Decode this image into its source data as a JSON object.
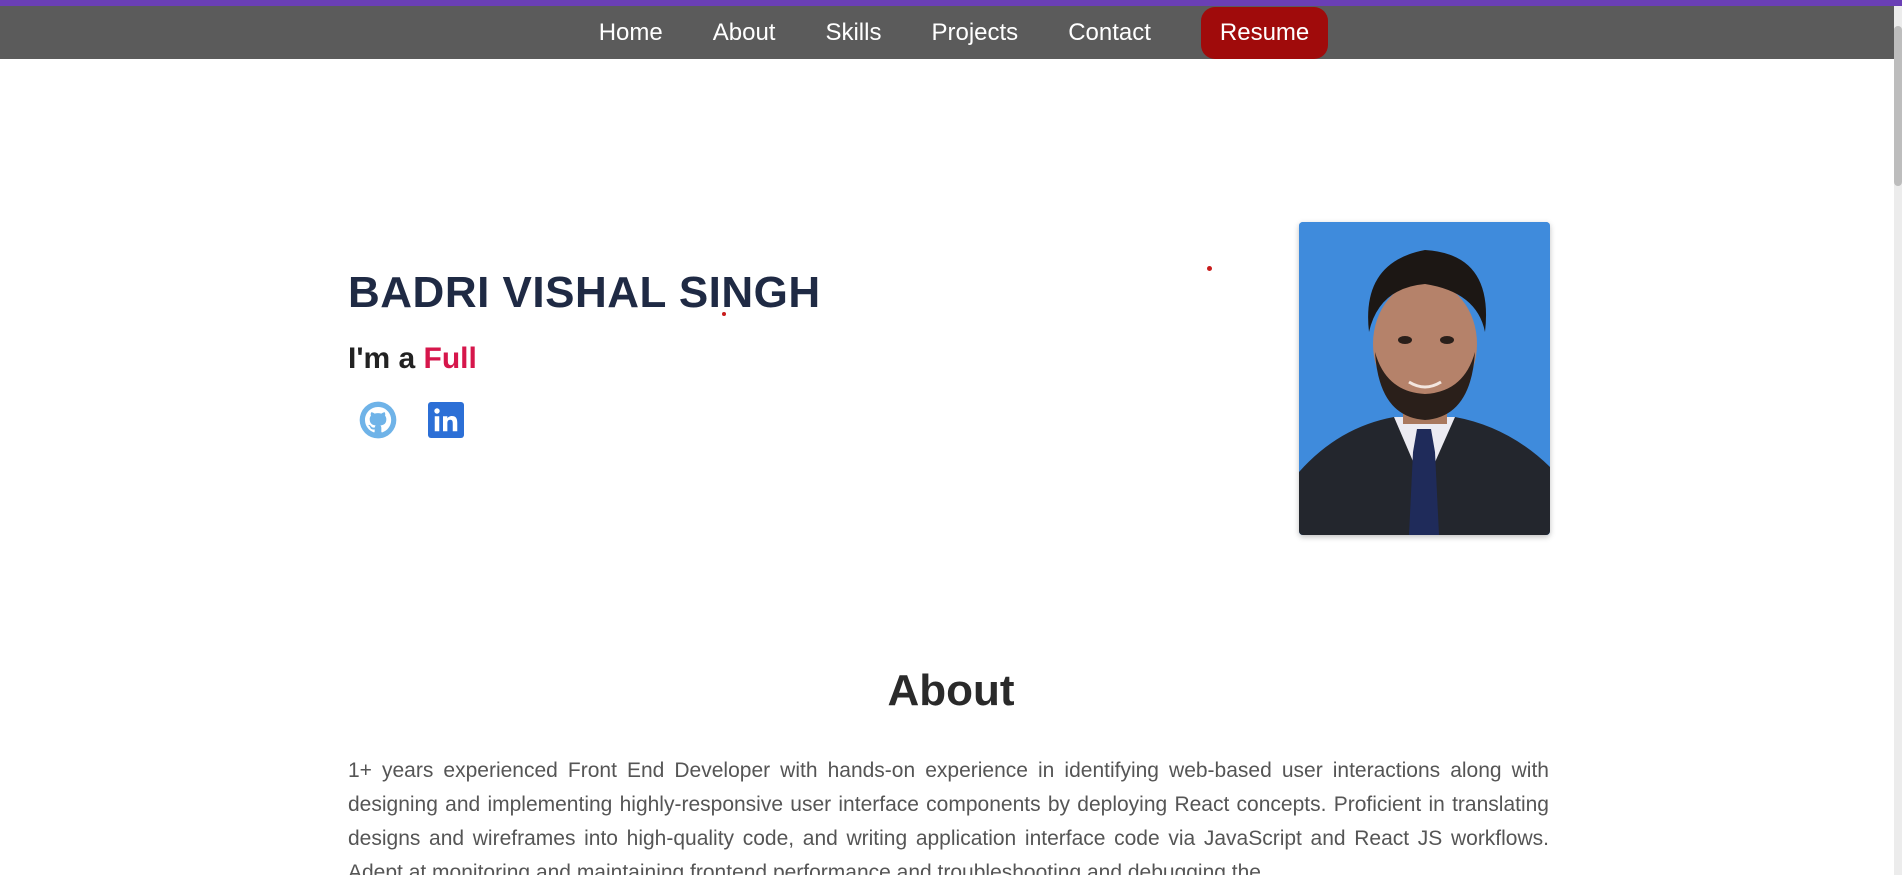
{
  "nav": {
    "items": [
      "Home",
      "About",
      "Skills",
      "Projects",
      "Contact"
    ],
    "resume_label": "Resume"
  },
  "hero": {
    "name": "BADRI VISHAL SINGH",
    "intro_prefix": "I'm a",
    "intro_role": "Full",
    "socials": [
      "github-icon",
      "linkedin-icon"
    ],
    "photo_alt": "profile-photo"
  },
  "about": {
    "title": "About",
    "text": "1+ years experienced Front End Developer with hands-on experience in identifying web-based user interactions along with designing and implementing highly-responsive user interface components by deploying React concepts. Proficient in translating designs and wireframes into high-quality code, and writing application interface code via JavaScript and React JS workflows. Adept at monitoring and maintaining frontend performance and troubleshooting and debugging the"
  },
  "colors": {
    "accent": "#d6164b",
    "resume_button": "#a00b0b",
    "nav_bg": "#5b5b5b",
    "top_line": "#6a3fb5"
  }
}
